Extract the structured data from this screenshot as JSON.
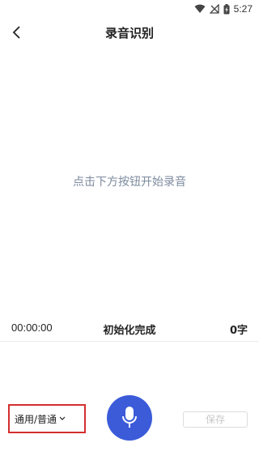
{
  "status_bar": {
    "time": "5:27"
  },
  "nav": {
    "title": "录音识别"
  },
  "main": {
    "hint": "点击下方按钮开始录音"
  },
  "info": {
    "elapsed": "00:00:00",
    "status": "初始化完成",
    "char_count": "0字"
  },
  "controls": {
    "language": "通用/普通",
    "save_label": "保存"
  },
  "colors": {
    "accent": "#3b5bd9",
    "hint": "#7d8a9e",
    "highlight_border": "#d32f2f"
  },
  "icons": {
    "back": "chevron-left-icon",
    "wifi": "wifi-icon",
    "signal": "no-signal-icon",
    "battery": "battery-charging-icon",
    "mic": "microphone-icon",
    "dropdown": "chevron-down-icon"
  }
}
